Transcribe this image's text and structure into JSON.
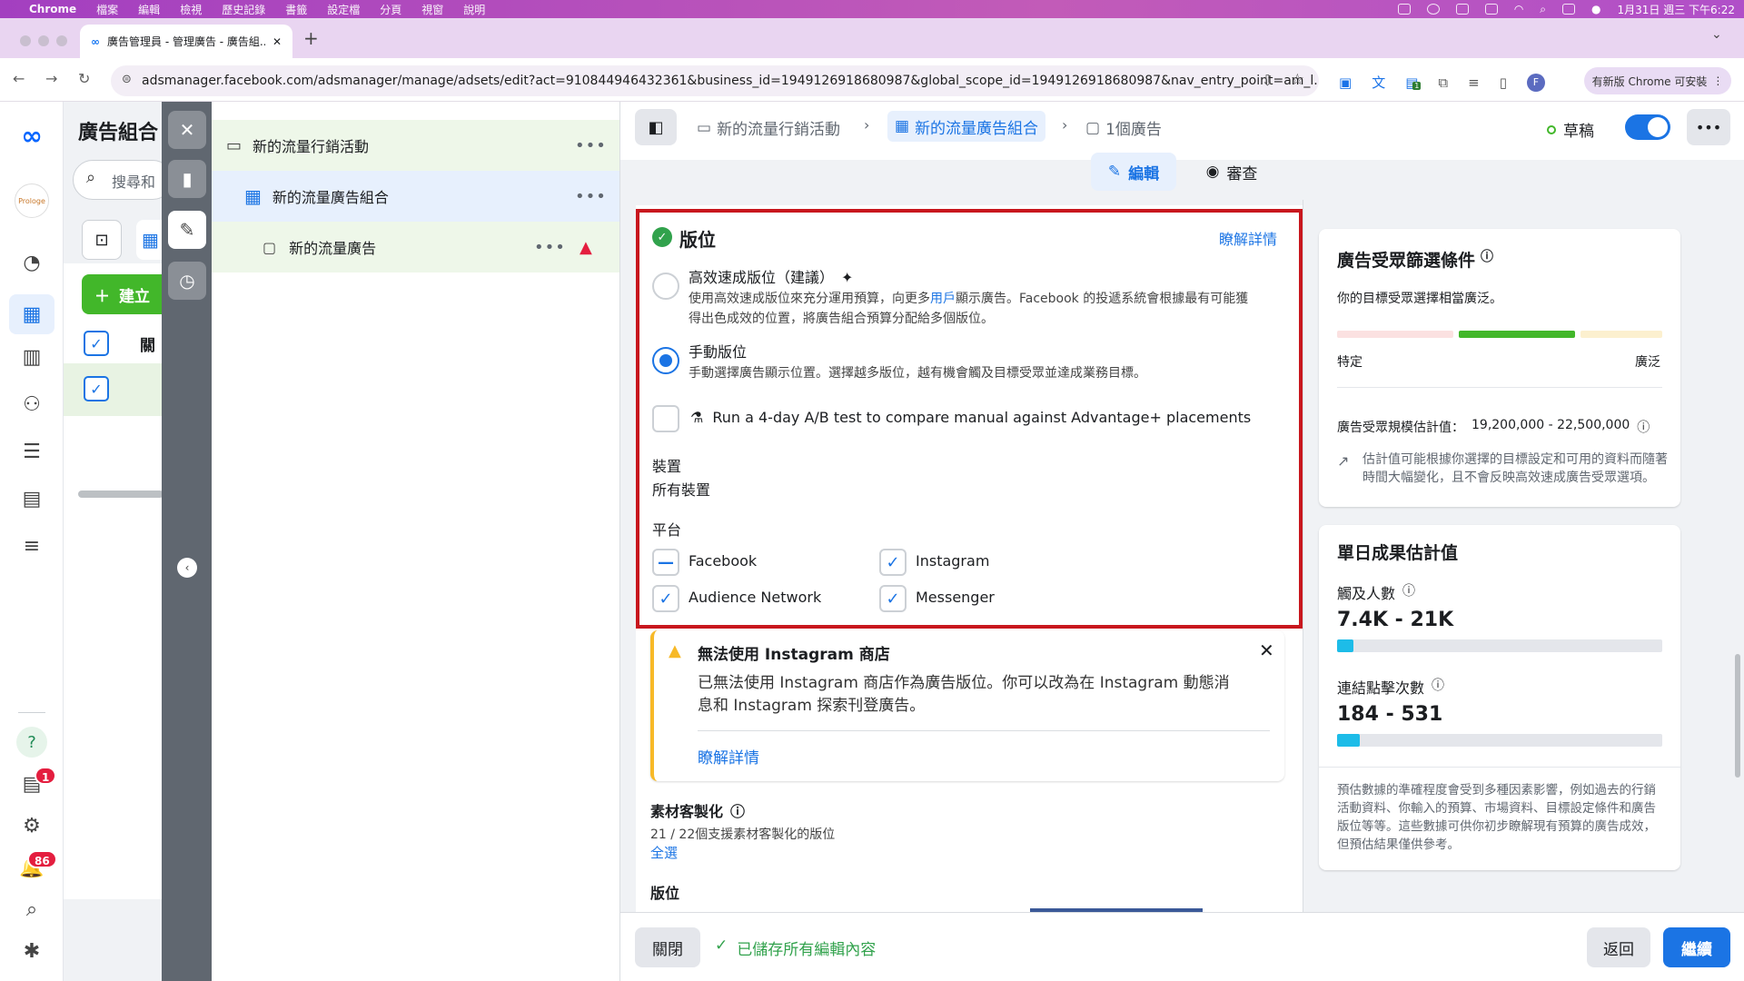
{
  "menubar": {
    "app": "Chrome",
    "items": [
      "檔案",
      "編輯",
      "檢視",
      "歷史記錄",
      "書籤",
      "設定檔",
      "分頁",
      "視窗",
      "說明"
    ],
    "clock": "1月31日 週三 下午6:22"
  },
  "browser": {
    "tab_title": "廣告管理員 - 管理廣告 - 廣告組...",
    "url": "adsmanager.facebook.com/adsmanager/manage/adsets/edit?act=910844946432361&business_id=1949126918680987&global_scope_id=1949126918680987&nav_entry_point=am_l...",
    "update_label": "有新版 Chrome 可安裝",
    "profile_initial": "F",
    "ext_badge": "1"
  },
  "leftnav": {
    "brand_badge": "Prologe",
    "notif_badge": "1",
    "alerts_badge": "86"
  },
  "campaign_panel": {
    "title": "廣告組合",
    "search_placeholder": "搜尋和",
    "create_label": "建立",
    "col_header": "關"
  },
  "tree": {
    "campaign": "新的流量行銷活動",
    "adset": "新的流量廣告組合",
    "ad": "新的流量廣告"
  },
  "breadcrumb": {
    "campaign": "新的流量行銷活動",
    "adset": "新的流量廣告組合",
    "ads": "1個廣告",
    "status": "草稿"
  },
  "tabs": {
    "edit": "編輯",
    "review": "審查"
  },
  "placement": {
    "title": "版位",
    "learn_more": "瞭解詳情",
    "advantage_title": "高效速成版位（建議）",
    "advantage_desc_1": "使用高效速成版位來充分運用預算，向更多",
    "advantage_desc_link": "用戶",
    "advantage_desc_2": "顯示廣告。Facebook 的投遞系統會根據最有可能獲",
    "advantage_desc_3": "得出色成效的位置，將廣告組合預算分配給多個版位。",
    "manual_title": "手動版位",
    "manual_desc": "手動選擇廣告顯示位置。選擇越多版位，越有機會觸及目標受眾並達成業務目標。",
    "ab_test": "Run a 4-day A/B test to compare manual against Advantage+ placements",
    "devices_label": "裝置",
    "devices_value": "所有裝置",
    "platforms_label": "平台",
    "platforms": [
      "Facebook",
      "Instagram",
      "Audience Network",
      "Messenger"
    ]
  },
  "warning": {
    "title": "無法使用 Instagram 商店",
    "body_1": "已無法使用 Instagram 商店作為廣告版位。你可以改為在 Instagram 動態消",
    "body_2": "息和 Instagram 探索刊登廣告。",
    "link": "瞭解詳情"
  },
  "customization": {
    "title": "素材客製化",
    "count": "21 / 22個支援素材客製化的版位",
    "select_all": "全選",
    "placements_label": "版位"
  },
  "audience": {
    "title": "廣告受眾篩選條件",
    "desc": "你的目標受眾選擇相當廣泛。",
    "specific": "特定",
    "broad": "廣泛",
    "size_label": "廣告受眾規模估計值：",
    "size_value": "19,200,000 - 22,500,000",
    "note_1": "估計值可能根據你選擇的目標設定和可用的資料而隨著",
    "note_2": "時間大幅變化，且不會反映高效速成廣告受眾選項。",
    "meter_level": "broad-middle"
  },
  "daily": {
    "title": "單日成果估計值",
    "reach_label": "觸及人數",
    "reach_value": "7.4K - 21K",
    "reach_fill": 0.05,
    "clicks_label": "連結點擊次數",
    "clicks_value": "184 - 531",
    "clicks_fill": 0.07,
    "note_1": "預估數據的準確程度會受到多種因素影響，例如過去的行銷",
    "note_2": "活動資料、你輸入的預算、市場資料、目標設定條件和廣告",
    "note_3": "版位等等。這些數據可供你初步瞭解現有預算的廣告成效，",
    "note_4": "但預估結果僅供參考。"
  },
  "footer": {
    "close": "關閉",
    "saved": "已儲存所有編輯內容",
    "back": "返回",
    "continue": "繼續"
  },
  "colors": {
    "accent": "#1b74e4",
    "success": "#31a24c",
    "warning": "#f7b928",
    "highlight_border": "#c8171e"
  }
}
